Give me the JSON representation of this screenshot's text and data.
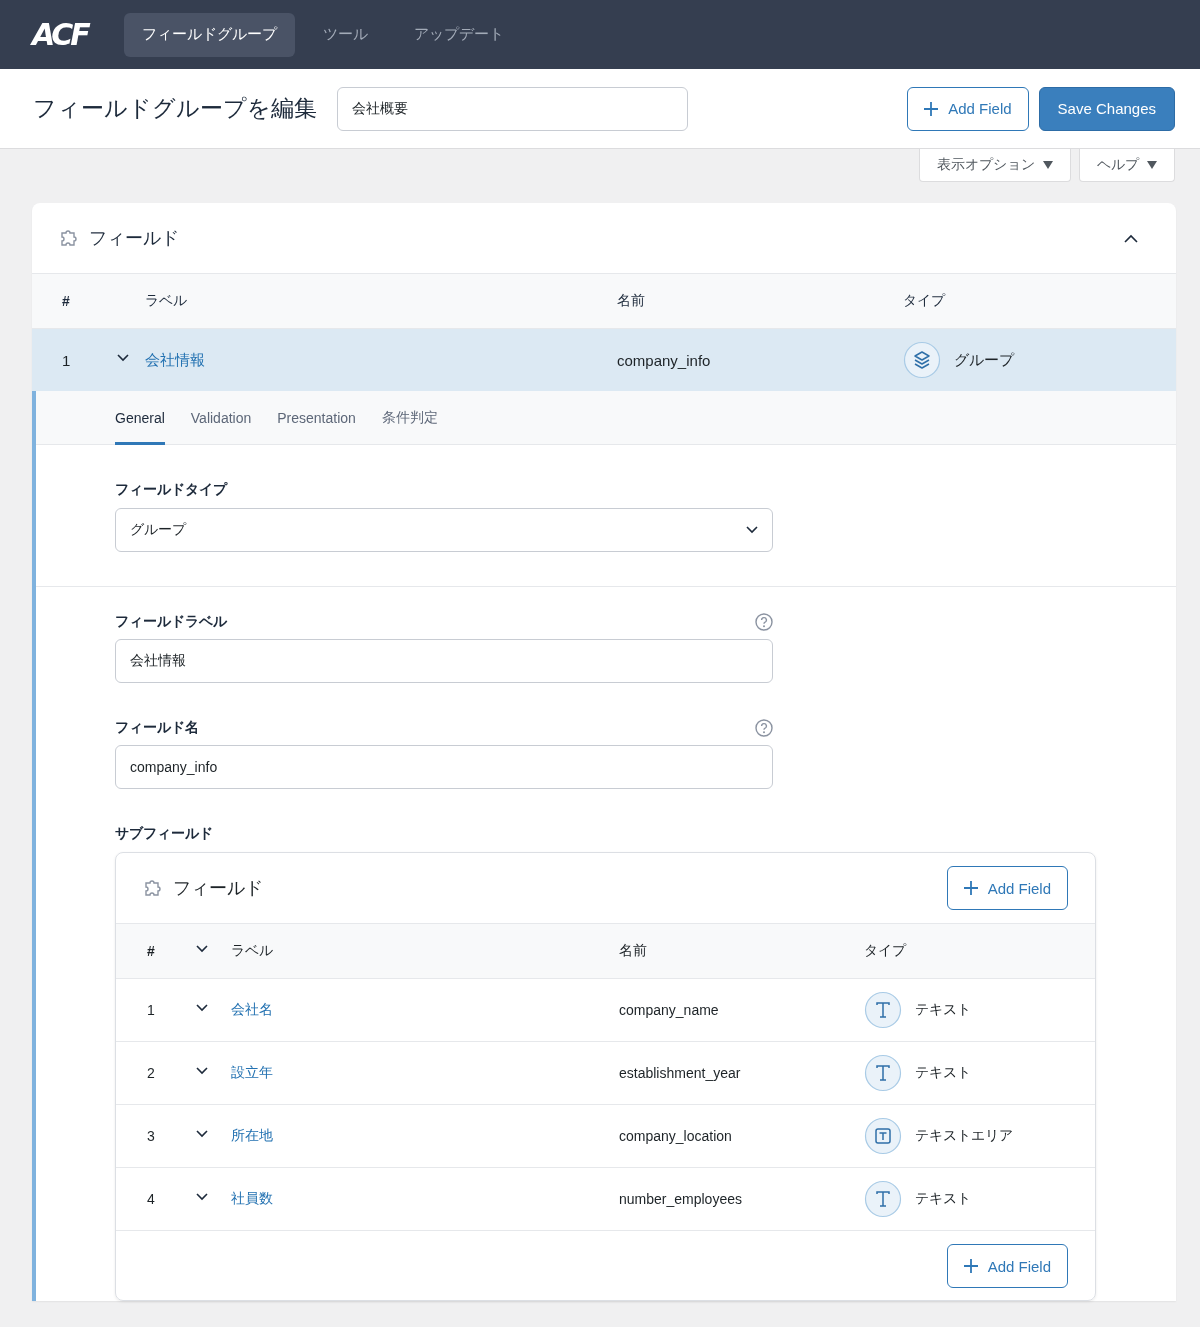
{
  "nav": {
    "logo": "ACF",
    "tabs": [
      {
        "label": "フィールドグループ",
        "selected": true
      },
      {
        "label": "ツール",
        "selected": false
      },
      {
        "label": "アップデート",
        "selected": false
      }
    ]
  },
  "header": {
    "title": "フィールドグループを編集",
    "group_title": "会社概要",
    "add_field": "Add Field",
    "save": "Save Changes"
  },
  "screen_options": [
    "表示オプション",
    "ヘルプ"
  ],
  "panel": {
    "title": "フィールド",
    "collapsed": false,
    "columns": [
      "#",
      "ラベル",
      "名前",
      "タイプ"
    ],
    "field": {
      "number": "1",
      "label": "会社情報",
      "name": "company_info",
      "type": "グループ",
      "kind": "group",
      "expanded": true
    },
    "settings_tabs": [
      {
        "label": "General",
        "selected": true
      },
      {
        "label": "Validation",
        "selected": false
      },
      {
        "label": "Presentation",
        "selected": false
      },
      {
        "label": "条件判定",
        "selected": false
      }
    ],
    "field_type": {
      "label": "フィールドタイプ",
      "value": "グループ"
    },
    "field_label": {
      "label": "フィールドラベル",
      "value": "会社情報"
    },
    "field_name": {
      "label": "フィールド名",
      "value": "company_info"
    },
    "subfields": {
      "label": "サブフィールド",
      "title": "フィールド",
      "add_field": "Add Field",
      "columns": [
        "#",
        "ラベル",
        "名前",
        "タイプ"
      ],
      "rows": [
        {
          "number": "1",
          "label": "会社名",
          "name": "company_name",
          "type": "テキスト",
          "kind": "text",
          "expanded": false
        },
        {
          "number": "2",
          "label": "設立年",
          "name": "establishment_year",
          "type": "テキスト",
          "kind": "text",
          "expanded": false
        },
        {
          "number": "3",
          "label": "所在地",
          "name": "company_location",
          "type": "テキストエリア",
          "kind": "textarea",
          "expanded": false
        },
        {
          "number": "4",
          "label": "社員数",
          "name": "number_employees",
          "type": "テキスト",
          "kind": "text",
          "expanded": false
        }
      ],
      "footer_add_field": "Add Field"
    }
  }
}
